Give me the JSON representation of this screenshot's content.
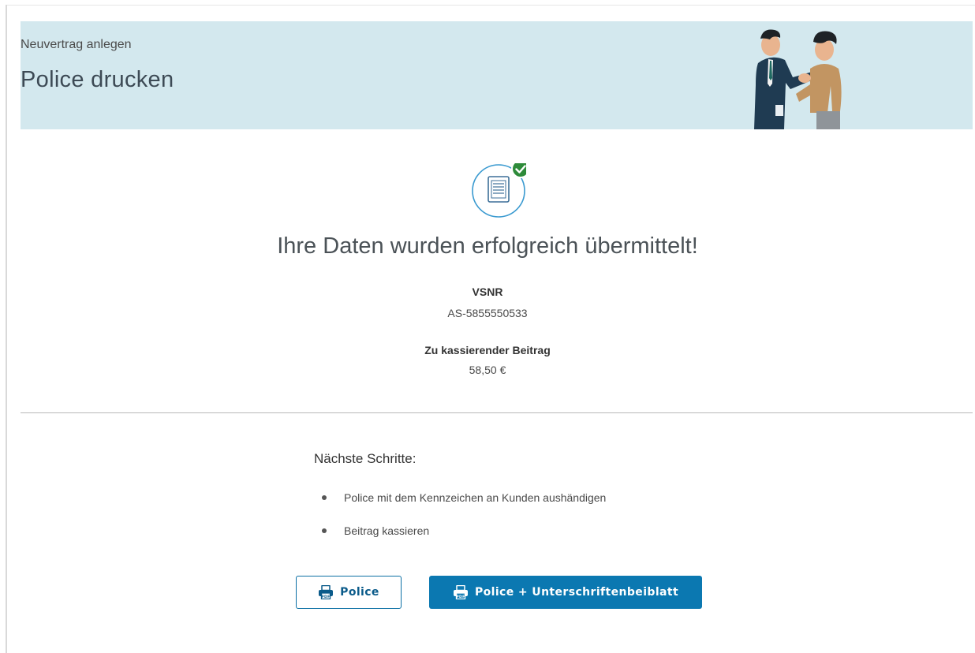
{
  "header": {
    "subtitle": "Neuvertrag anlegen",
    "title": "Police drucken",
    "illustration": "handshake-illustration"
  },
  "success": {
    "icon": "document-check-icon",
    "headline": "Ihre Daten wurden erfolgreich übermittelt!",
    "vsnr_label": "VSNR",
    "vsnr_value": "AS-5855550533",
    "premium_label": "Zu kassierender Beitrag",
    "premium_value": "58,50 €"
  },
  "next_steps": {
    "title": "Nächste Schritte:",
    "items": [
      "Police mit dem Kennzeichen an Kunden aushändigen",
      "Beitrag kassieren"
    ]
  },
  "buttons": {
    "police_label": "Police",
    "police_signature_label": "Police + Unterschriftenbeiblatt",
    "icon": "pdf-print-icon"
  },
  "colors": {
    "banner_bg": "#d3e8ee",
    "primary": "#0b78b1",
    "success_green": "#2e8b3a"
  }
}
